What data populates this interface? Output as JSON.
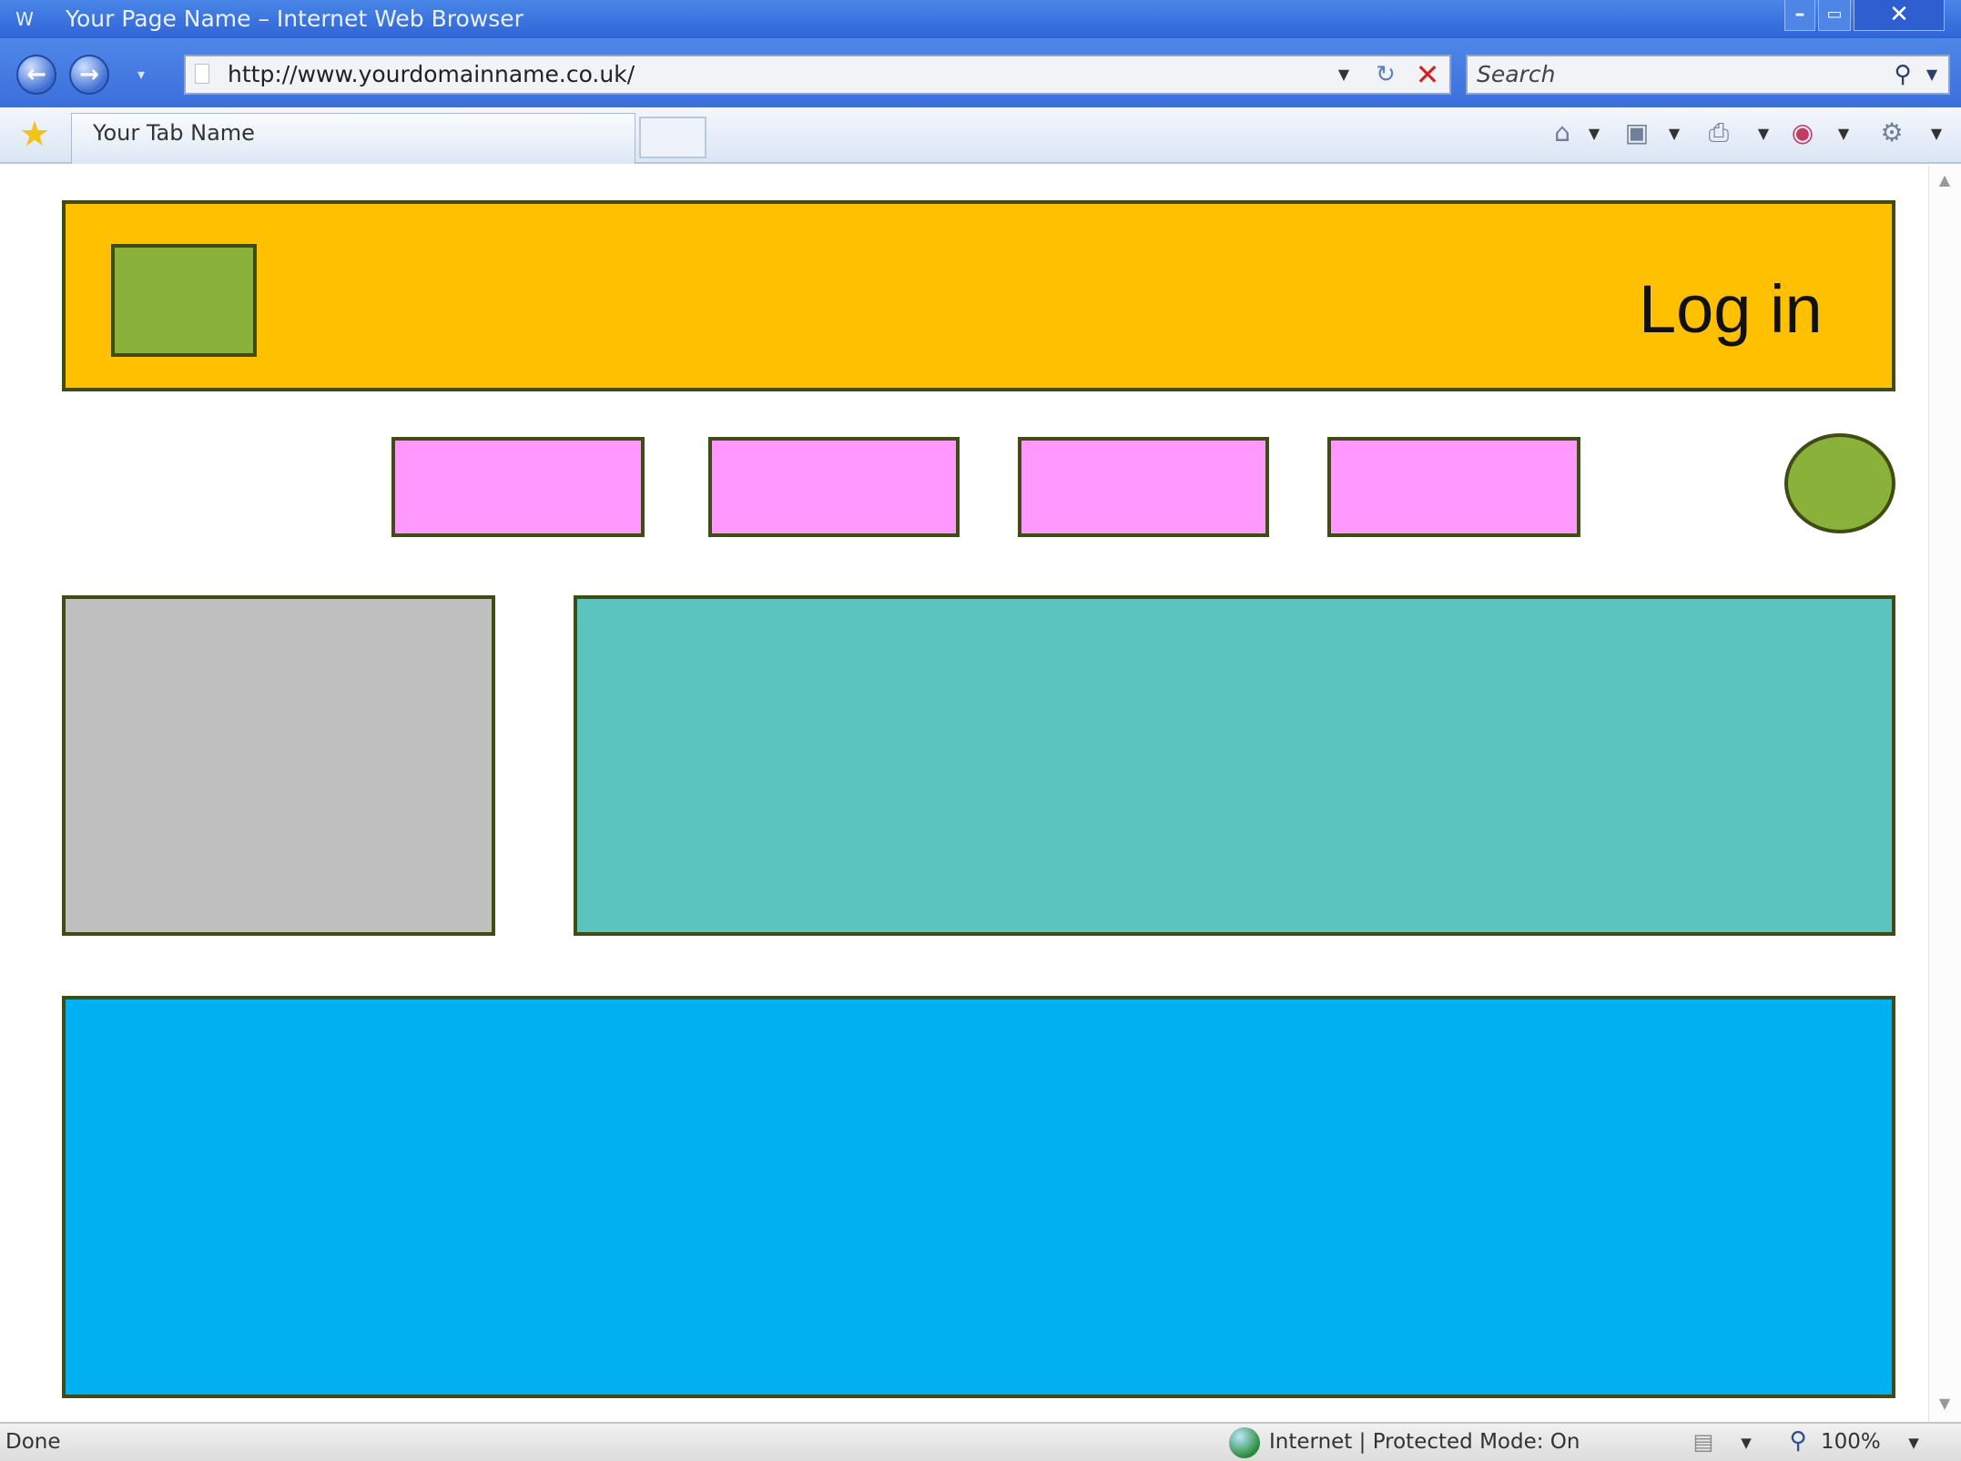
{
  "window": {
    "title": "Your Page Name – Internet Web Browser",
    "app_icon": "W",
    "controls": {
      "minimize": "–",
      "maximize": "▭",
      "close": "✕"
    }
  },
  "navigation": {
    "back_icon": "back-arrow-icon",
    "forward_icon": "forward-arrow-icon",
    "address": "http://www.yourdomainname.co.uk/",
    "search_placeholder": "Search"
  },
  "tabs": [
    {
      "label": "Your Tab Name"
    }
  ],
  "toolbar_icons": [
    "home-icon",
    "feeds-icon",
    "print-icon",
    "page-menu-icon",
    "tools-icon"
  ],
  "page": {
    "header": {
      "login_label": "Log in"
    },
    "nav_items": 4,
    "colors": {
      "header": "#ffc000",
      "logo": "#8ab23a",
      "nav_boxes": "#ff99ff",
      "nav_circle": "#8ab23a",
      "side_panel": "#bfbfbf",
      "main_panel": "#5cc4be",
      "bottom_panel": "#00b0f0",
      "outline": "#3f4d14"
    }
  },
  "status": {
    "left": "Done",
    "zone": "Internet | Protected Mode: On",
    "zoom": "100%"
  }
}
